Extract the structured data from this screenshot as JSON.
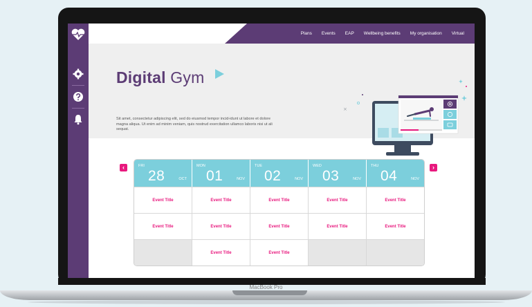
{
  "device": {
    "label": "MacBook Pro"
  },
  "rail": {
    "icons": [
      "heart-logo-icon",
      "gear-icon",
      "help-icon",
      "bell-icon"
    ]
  },
  "nav": {
    "items": [
      {
        "label": "Plans"
      },
      {
        "label": "Events"
      },
      {
        "label": "EAP"
      },
      {
        "label": "Wellbeing benefits"
      },
      {
        "label": "My organisation"
      },
      {
        "label": "Virtual"
      }
    ]
  },
  "hero": {
    "title_bold": "Digital",
    "title_light": "Gym",
    "body": "Sit amet, consectetur adipiscing elit, sed do eiusmod tempor incid-idunt ut labore et dolore magna aliqua. Ut enim ad minim veniam, quis nostrud exercitation ullamco laboris nisi ut ali sequat."
  },
  "calendar": {
    "prev_label": "‹",
    "next_label": "›",
    "days": [
      {
        "dow": "FRI",
        "num": "28",
        "mon": "OCT"
      },
      {
        "dow": "MON",
        "num": "01",
        "mon": "NOV"
      },
      {
        "dow": "TUE",
        "num": "02",
        "mon": "NOV"
      },
      {
        "dow": "WED",
        "num": "03",
        "mon": "NOV"
      },
      {
        "dow": "THU",
        "num": "04",
        "mon": "NOV"
      }
    ],
    "rows": [
      [
        "Event Title",
        "Event Title",
        "Event Title",
        "Event Title",
        "Event Title"
      ],
      [
        "Event Title",
        "Event Title",
        "Event Title",
        "Event Title",
        "Event Title"
      ],
      [
        "",
        "Event Title",
        "Event Title",
        "",
        ""
      ]
    ]
  },
  "colors": {
    "brand_purple": "#5c3c75",
    "accent_pink": "#e8197e",
    "header_cyan": "#7ccfdc"
  }
}
